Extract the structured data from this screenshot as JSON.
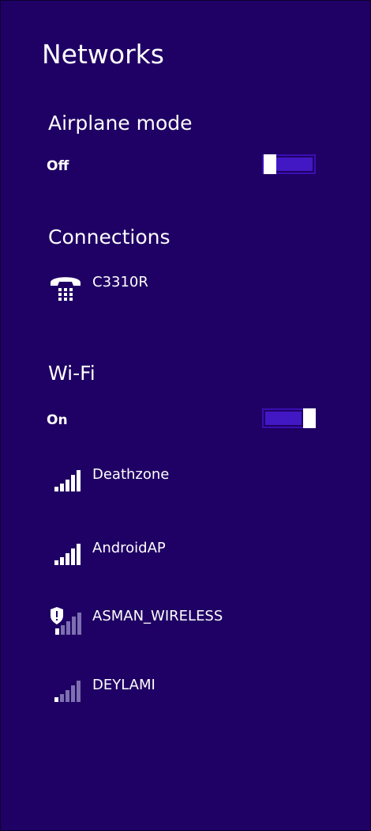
{
  "header": {
    "title": "Networks"
  },
  "airplane": {
    "heading": "Airplane mode",
    "state": "Off",
    "on": false
  },
  "connections": {
    "heading": "Connections",
    "items": [
      {
        "name": "C3310R",
        "icon": "phone-keypad-icon"
      }
    ]
  },
  "wifi": {
    "heading": "Wi-Fi",
    "state": "On",
    "on": true,
    "networks": [
      {
        "name": "Deathzone",
        "signal": 5,
        "secured_warning": false,
        "icon": "wifi-signal-icon"
      },
      {
        "name": "AndroidAP",
        "signal": 4,
        "secured_warning": false,
        "icon": "wifi-signal-icon"
      },
      {
        "name": "ASMAN_WIRELESS",
        "signal": 1,
        "secured_warning": true,
        "icon": "wifi-signal-shield-icon"
      },
      {
        "name": "DEYLAMI",
        "signal": 1,
        "secured_warning": false,
        "icon": "wifi-signal-icon"
      }
    ]
  },
  "colors": {
    "background": "#1f0064",
    "accent": "#4218c4",
    "text": "#ffffff",
    "dim_bar": "#7d6fb0"
  }
}
